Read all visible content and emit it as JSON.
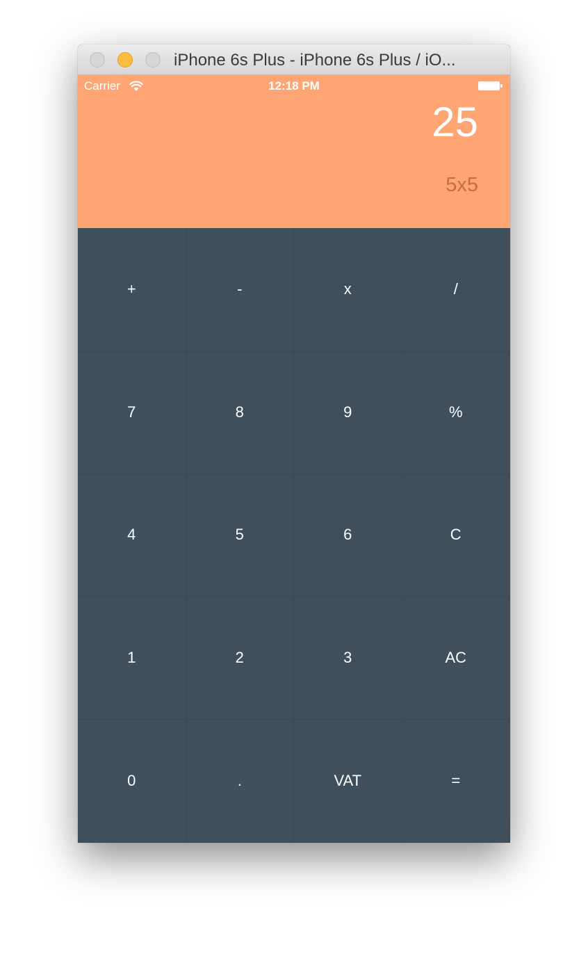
{
  "window": {
    "title": "iPhone 6s Plus - iPhone 6s Plus / iO..."
  },
  "statusbar": {
    "carrier": "Carrier",
    "time": "12:18 PM"
  },
  "display": {
    "result": "25",
    "expression": "5x5"
  },
  "keypad": {
    "keys": [
      {
        "label": "+",
        "name": "plus"
      },
      {
        "label": "-",
        "name": "minus"
      },
      {
        "label": "x",
        "name": "multiply"
      },
      {
        "label": "/",
        "name": "divide"
      },
      {
        "label": "7",
        "name": "7"
      },
      {
        "label": "8",
        "name": "8"
      },
      {
        "label": "9",
        "name": "9"
      },
      {
        "label": "%",
        "name": "percent"
      },
      {
        "label": "4",
        "name": "4"
      },
      {
        "label": "5",
        "name": "5"
      },
      {
        "label": "6",
        "name": "6"
      },
      {
        "label": "C",
        "name": "clear"
      },
      {
        "label": "1",
        "name": "1"
      },
      {
        "label": "2",
        "name": "2"
      },
      {
        "label": "3",
        "name": "3"
      },
      {
        "label": "AC",
        "name": "all-clear"
      },
      {
        "label": "0",
        "name": "0"
      },
      {
        "label": ".",
        "name": "decimal"
      },
      {
        "label": "VAT",
        "name": "vat"
      },
      {
        "label": "=",
        "name": "equals"
      }
    ]
  },
  "colors": {
    "display_background": "#ffa574",
    "keypad_background": "#3f505c",
    "expression_text": "#c46f3c",
    "minimize_light": "#fcbe3c"
  },
  "icons": [
    "close-light",
    "minimize-light",
    "zoom-light",
    "wifi-icon",
    "battery-icon"
  ]
}
